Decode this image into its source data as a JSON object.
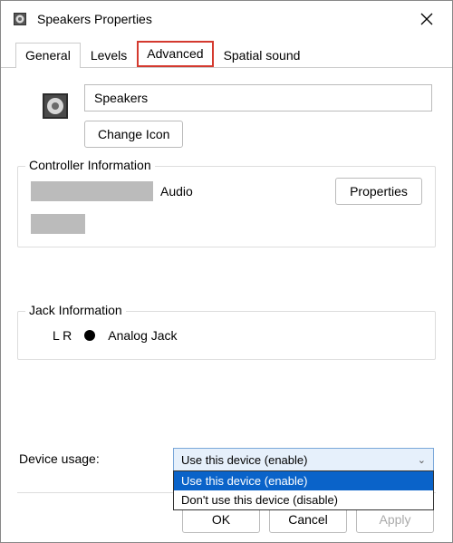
{
  "window": {
    "title": "Speakers Properties"
  },
  "tabs": {
    "general": "General",
    "levels": "Levels",
    "advanced": "Advanced",
    "spatial": "Spatial sound"
  },
  "device": {
    "name": "Speakers",
    "change_icon": "Change Icon"
  },
  "controller": {
    "legend": "Controller Information",
    "audio_label": "Audio",
    "properties_btn": "Properties"
  },
  "jack": {
    "legend": "Jack Information",
    "channels": "L R",
    "type": "Analog Jack"
  },
  "usage": {
    "label": "Device usage:",
    "selected": "Use this device (enable)",
    "options": {
      "enable": "Use this device (enable)",
      "disable": "Don't use this device (disable)"
    }
  },
  "buttons": {
    "ok": "OK",
    "cancel": "Cancel",
    "apply": "Apply"
  }
}
